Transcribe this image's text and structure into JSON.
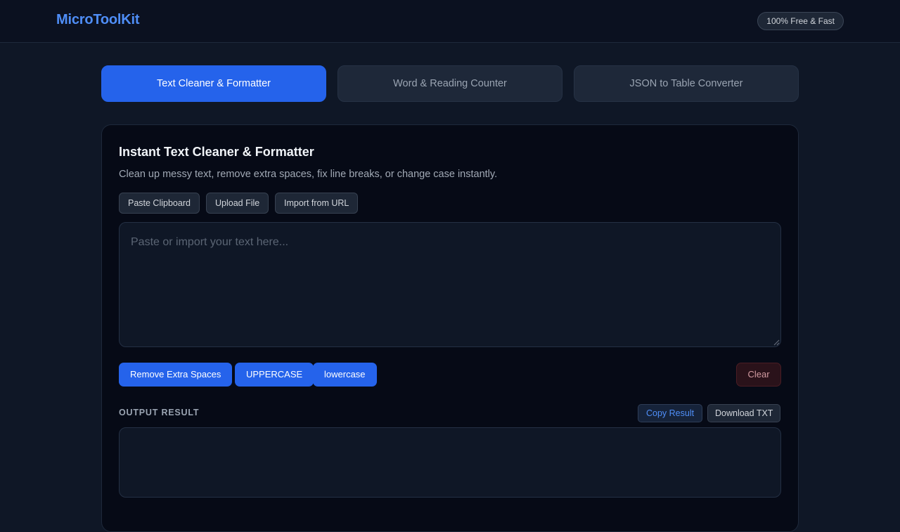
{
  "header": {
    "brand": "MicroToolKit",
    "badge": "100% Free & Fast"
  },
  "tabs": [
    {
      "label": "Text Cleaner & Formatter",
      "active": true
    },
    {
      "label": "Word & Reading Counter",
      "active": false
    },
    {
      "label": "JSON to Table Converter",
      "active": false
    }
  ],
  "tool": {
    "title": "Instant Text Cleaner & Formatter",
    "description": "Clean up messy text, remove extra spaces, fix line breaks, or change case instantly.",
    "import_buttons": [
      "Paste Clipboard",
      "Upload File",
      "Import from URL"
    ],
    "input": {
      "value": "",
      "placeholder": "Paste or import your text here..."
    },
    "actions": [
      "Remove Extra Spaces",
      "UPPERCASE",
      "lowercase"
    ],
    "clear_label": "Clear",
    "output": {
      "label": "OUTPUT RESULT",
      "copy_label": "Copy Result",
      "download_label": "Download TXT",
      "value": ""
    }
  },
  "colors": {
    "accent": "#2563eb",
    "brand": "#4f8ef7",
    "background": "#0f1726",
    "card": "#060a16"
  }
}
